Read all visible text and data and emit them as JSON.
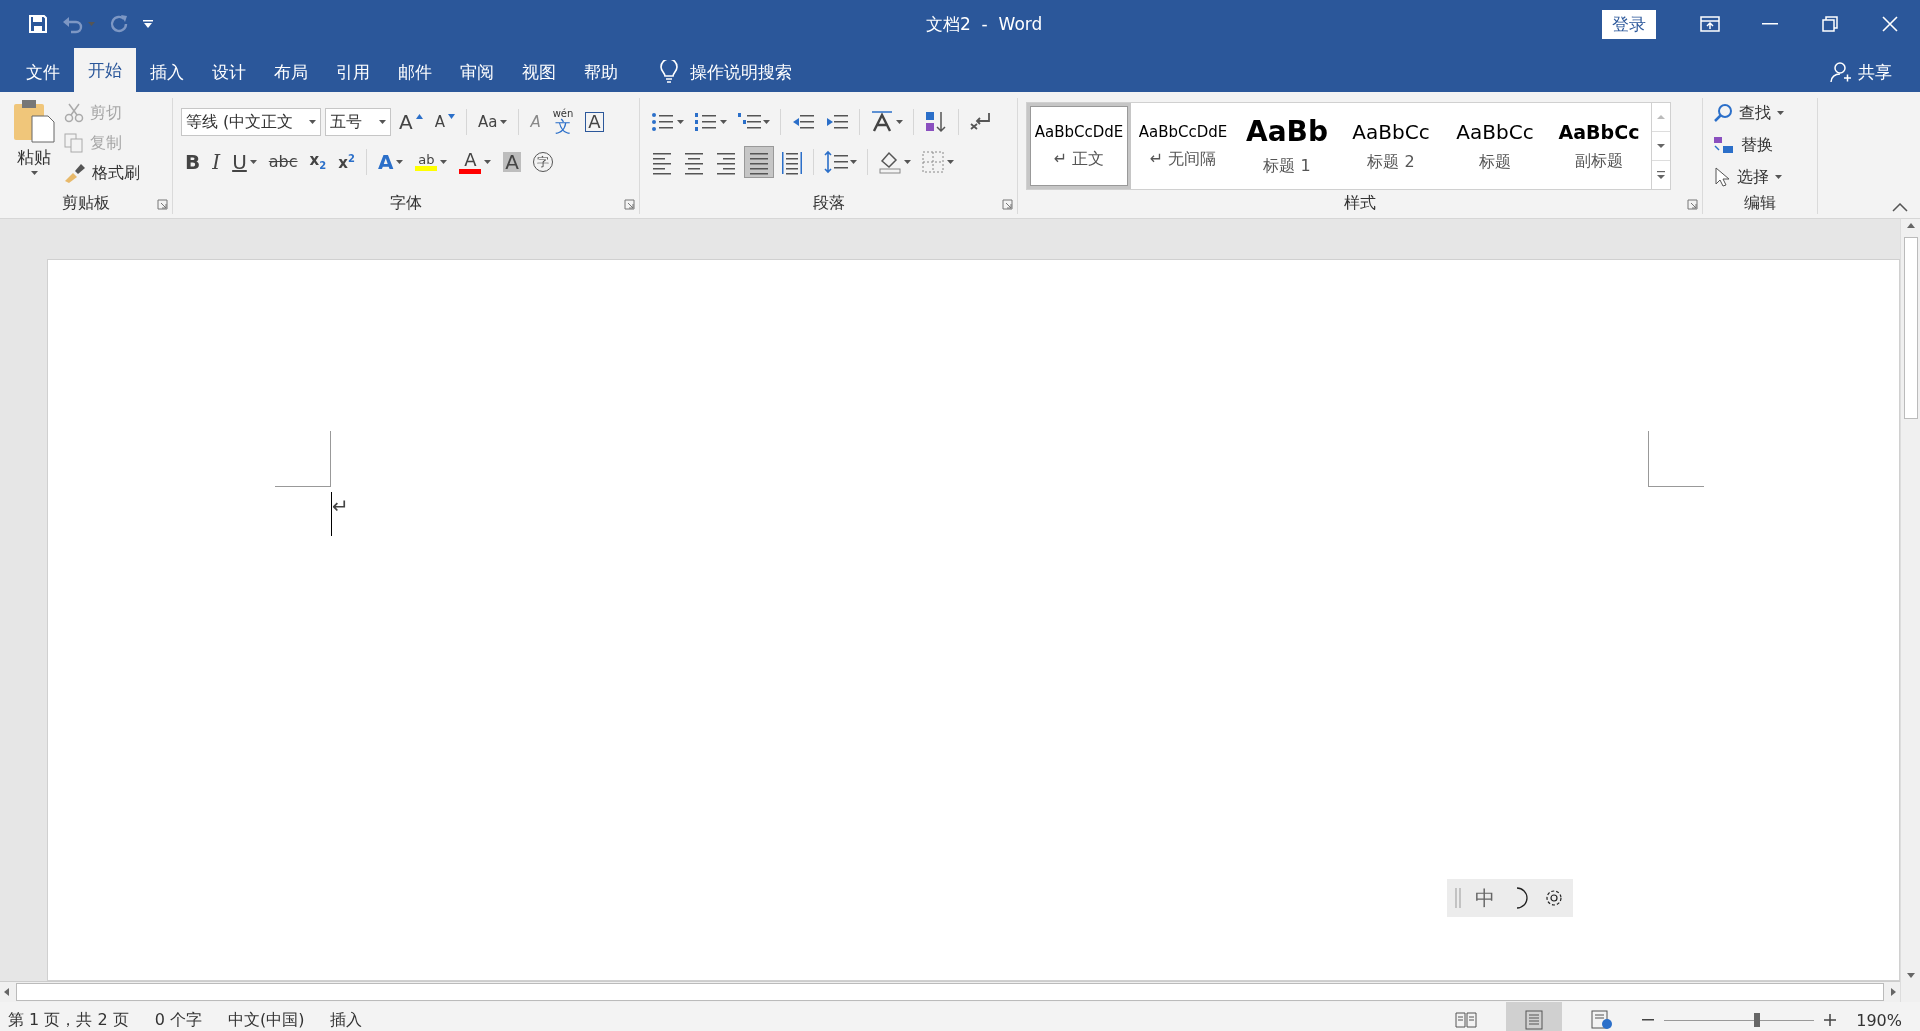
{
  "quick_access": [
    {
      "kind": "save",
      "disabled": false
    },
    {
      "kind": "undo",
      "disabled": true
    },
    {
      "kind": "redo",
      "disabled": true
    },
    {
      "kind": "customize",
      "disabled": false
    }
  ],
  "window": {
    "title": "文档2  -  Word",
    "sign_in": "登录"
  },
  "tabs": [
    {
      "label": "文件",
      "selected": false
    },
    {
      "label": "开始",
      "selected": true
    },
    {
      "label": "插入",
      "selected": false
    },
    {
      "label": "设计",
      "selected": false
    },
    {
      "label": "布局",
      "selected": false
    },
    {
      "label": "引用",
      "selected": false
    },
    {
      "label": "邮件",
      "selected": false
    },
    {
      "label": "审阅",
      "selected": false
    },
    {
      "label": "视图",
      "selected": false
    },
    {
      "label": "帮助",
      "selected": false
    }
  ],
  "tell_me": "操作说明搜索",
  "share": "共享",
  "clipboard": {
    "group": "剪贴板",
    "paste": "粘贴",
    "cut": {
      "label": "剪切",
      "disabled": true
    },
    "copy": {
      "label": "复制",
      "disabled": true
    },
    "format_painter": {
      "label": "格式刷",
      "disabled": false
    }
  },
  "font": {
    "group": "字体",
    "font_name": "等线 (中文正文",
    "font_size": "五号",
    "buttons": [
      {
        "kind": "grow",
        "glyph": "A",
        "dropdown": false
      },
      {
        "kind": "shrink",
        "glyph": "A",
        "dropdown": false
      },
      {
        "kind": "case",
        "glyph": "Aa",
        "dropdown": true
      },
      {
        "kind": "clear",
        "glyph": "A",
        "dropdown": false
      },
      {
        "kind": "phonetic",
        "glyph": "文",
        "ruby": "wén",
        "dropdown": false
      },
      {
        "kind": "border",
        "glyph": "A",
        "dropdown": false
      }
    ],
    "format_buttons": [
      {
        "kind": "bold",
        "glyph": "B",
        "dropdown": false
      },
      {
        "kind": "italic",
        "glyph": "I",
        "dropdown": false
      },
      {
        "kind": "underline",
        "glyph": "U",
        "dropdown": true
      },
      {
        "kind": "strike",
        "glyph": "abc",
        "dropdown": false
      },
      {
        "kind": "subscript",
        "glyph": "x",
        "index": "2",
        "dropdown": false
      },
      {
        "kind": "superscript",
        "glyph": "x",
        "index": "2",
        "dropdown": false
      },
      {
        "kind": "effects",
        "glyph": "A",
        "dropdown": true
      },
      {
        "kind": "highlight",
        "glyph": "ab",
        "color": "#ffff00",
        "dropdown": true
      },
      {
        "kind": "color",
        "glyph": "A",
        "color": "#ff0000",
        "dropdown": true
      },
      {
        "kind": "shading",
        "glyph": "A",
        "dropdown": false
      },
      {
        "kind": "enclose",
        "glyph": "字",
        "dropdown": false
      }
    ]
  },
  "paragraph": {
    "group": "段落",
    "alignment": [
      {
        "kind": "left",
        "selected": false
      },
      {
        "kind": "center",
        "selected": false
      },
      {
        "kind": "right",
        "selected": false
      },
      {
        "kind": "justify",
        "selected": true
      },
      {
        "kind": "distributed",
        "selected": false
      }
    ]
  },
  "styles": {
    "group": "样式",
    "items": [
      {
        "kind": "normal",
        "sample": "AaBbCcDdE",
        "name": "正文",
        "mark": "↵",
        "selected": true
      },
      {
        "kind": "normal",
        "sample": "AaBbCcDdE",
        "name": "无间隔",
        "mark": "↵",
        "selected": false
      },
      {
        "kind": "heading1",
        "sample": "AaBb",
        "name": "标题 1",
        "selected": false
      },
      {
        "kind": "heading2",
        "sample": "AaBbCc",
        "name": "标题 2",
        "selected": false
      },
      {
        "kind": "title",
        "sample": "AaBbCc",
        "name": "标题",
        "selected": false
      },
      {
        "kind": "subtitle",
        "sample": "AaBbCc",
        "name": "副标题",
        "selected": false
      }
    ]
  },
  "editing": {
    "group": "编辑",
    "find": "查找",
    "replace": "替换",
    "select": "选择"
  },
  "document": {
    "paragraph_mark": "↵"
  },
  "ime_bar": {
    "mode": "中"
  },
  "status_bar": {
    "page": "第 1 页，共 2 页",
    "words": "0 个字",
    "language": "中文(中国)",
    "mode": "插入",
    "views": [
      {
        "kind": "read",
        "selected": false
      },
      {
        "kind": "print",
        "selected": true
      },
      {
        "kind": "web",
        "selected": false
      }
    ],
    "zoom": {
      "level": 0.62,
      "reading": "190%"
    }
  }
}
